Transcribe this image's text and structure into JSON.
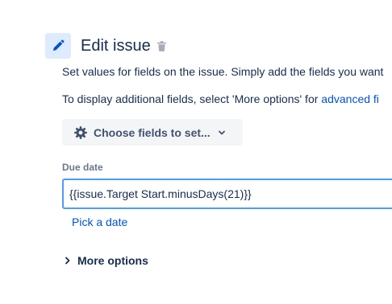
{
  "header": {
    "title": "Edit issue",
    "edit_icon": "pencil-icon",
    "delete_icon": "trash-icon"
  },
  "description": {
    "line1": "Set values for fields on the issue. Simply add the fields you want",
    "line2_prefix": "To display additional fields, select 'More options' for ",
    "line2_link": "advanced fi"
  },
  "choose_fields": {
    "label": "Choose fields to set...",
    "icon": "gear-icon",
    "chevron": "chevron-down-icon"
  },
  "due_date": {
    "label": "Due date",
    "value": "{{issue.Target Start.minusDays(21)}}",
    "pick_link": "Pick a date"
  },
  "more_options": {
    "label": "More options",
    "chevron": "chevron-right-icon"
  },
  "colors": {
    "accent": "#0052cc",
    "text": "#172b4d",
    "badge_bg": "#deebff",
    "button_bg": "#f4f5f7",
    "focus_border": "#4c9aff",
    "label": "#6b778c"
  }
}
